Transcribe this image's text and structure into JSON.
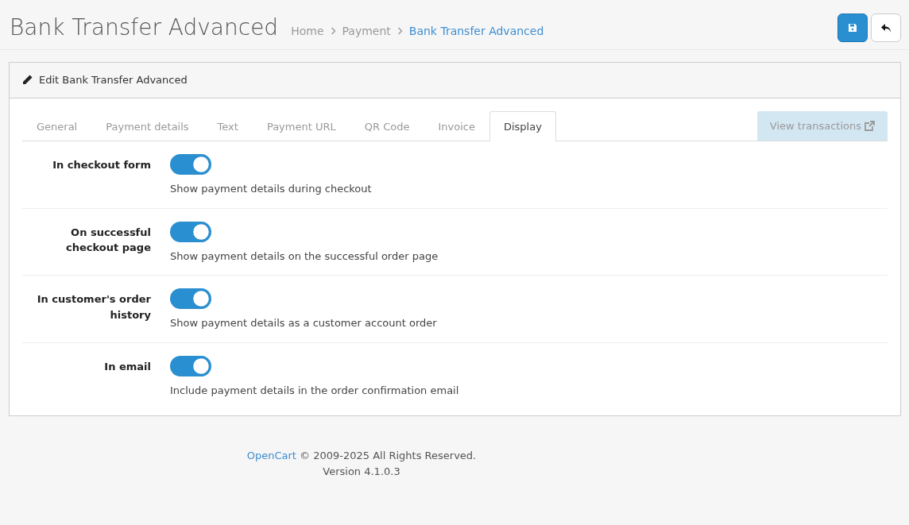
{
  "page": {
    "title": "Bank Transfer Advanced"
  },
  "breadcrumb": [
    {
      "label": "Home",
      "selected": false
    },
    {
      "label": "Payment",
      "selected": false
    },
    {
      "label": "Bank Transfer Advanced",
      "selected": true
    }
  ],
  "card": {
    "title": "Edit Bank Transfer Advanced"
  },
  "tabs": [
    {
      "label": "General",
      "selected": false
    },
    {
      "label": "Payment details",
      "selected": false
    },
    {
      "label": "Text",
      "selected": false
    },
    {
      "label": "Payment URL",
      "selected": false
    },
    {
      "label": "QR Code",
      "selected": false
    },
    {
      "label": "Invoice",
      "selected": false
    },
    {
      "label": "Display",
      "selected": true
    }
  ],
  "view_button": {
    "label": "View transactions",
    "disabled": true
  },
  "settings": [
    {
      "label": "In checkout form",
      "on": true,
      "help": "Show payment details during checkout"
    },
    {
      "label": "On successful checkout page",
      "on": true,
      "help": "Show payment details on the successful order page"
    },
    {
      "label": "In customer's order history",
      "on": true,
      "help": "Show payment details as a customer account order"
    },
    {
      "label": "In email",
      "on": true,
      "help": "Include payment details in the order confirmation email"
    }
  ],
  "footer": {
    "link": "OpenCart",
    "text": "© 2009-2025 All Rights Reserved.",
    "version": "Version 4.1.0.3"
  }
}
